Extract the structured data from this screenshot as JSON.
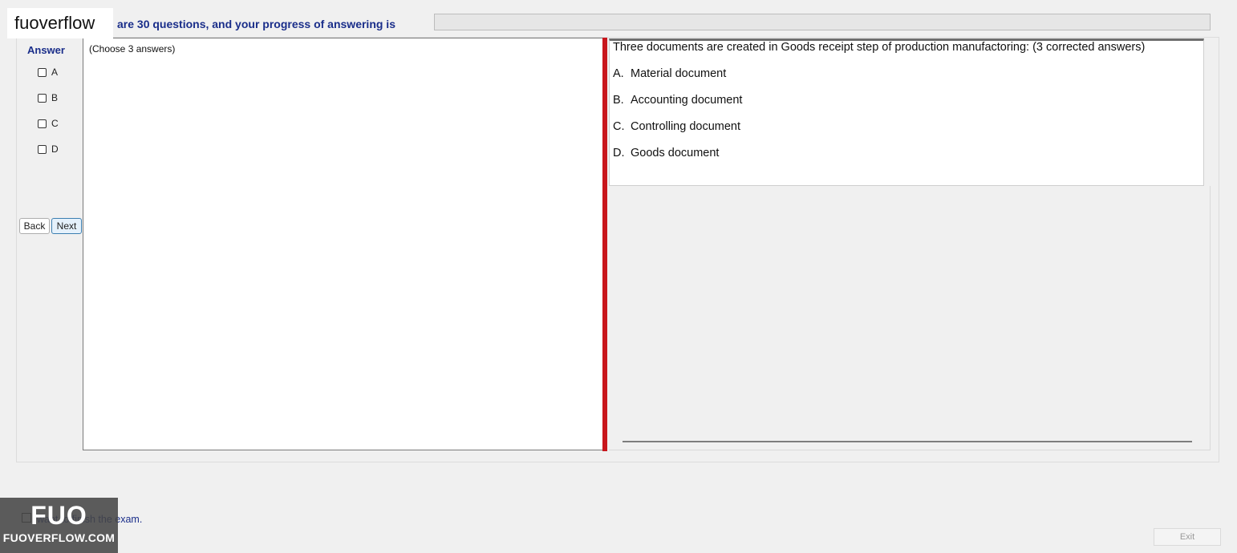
{
  "header": {
    "text": "are 30 questions, and your progress of answering is",
    "progress_fraction": 0
  },
  "watermark": {
    "top_label": "fuoverflow",
    "logo_big": "FUO",
    "logo_small": "FUOVERFLOW.COM"
  },
  "answer_panel": {
    "title": "Answer",
    "options": [
      {
        "label": "A",
        "checked": false
      },
      {
        "label": "B",
        "checked": false
      },
      {
        "label": "C",
        "checked": false
      },
      {
        "label": "D",
        "checked": false
      }
    ],
    "back_label": "Back",
    "next_label": "Next"
  },
  "left_area": {
    "instruction": "(Choose 3 answers)"
  },
  "question": {
    "text": "Three documents are created in Goods receipt step of production manufactoring: (3 corrected answers)",
    "choices": [
      {
        "letter": "A.",
        "text": "Material document"
      },
      {
        "letter": "B.",
        "text": "Accounting document"
      },
      {
        "letter": "C.",
        "text": "Controlling document"
      },
      {
        "letter": "D.",
        "text": "Goods document"
      }
    ]
  },
  "footer": {
    "finish_text": "want to finish the exam.",
    "finish_checked": false,
    "exit_label": "Exit"
  },
  "colors": {
    "accent_text": "#1a2e8a",
    "splitter": "#c8161c"
  }
}
